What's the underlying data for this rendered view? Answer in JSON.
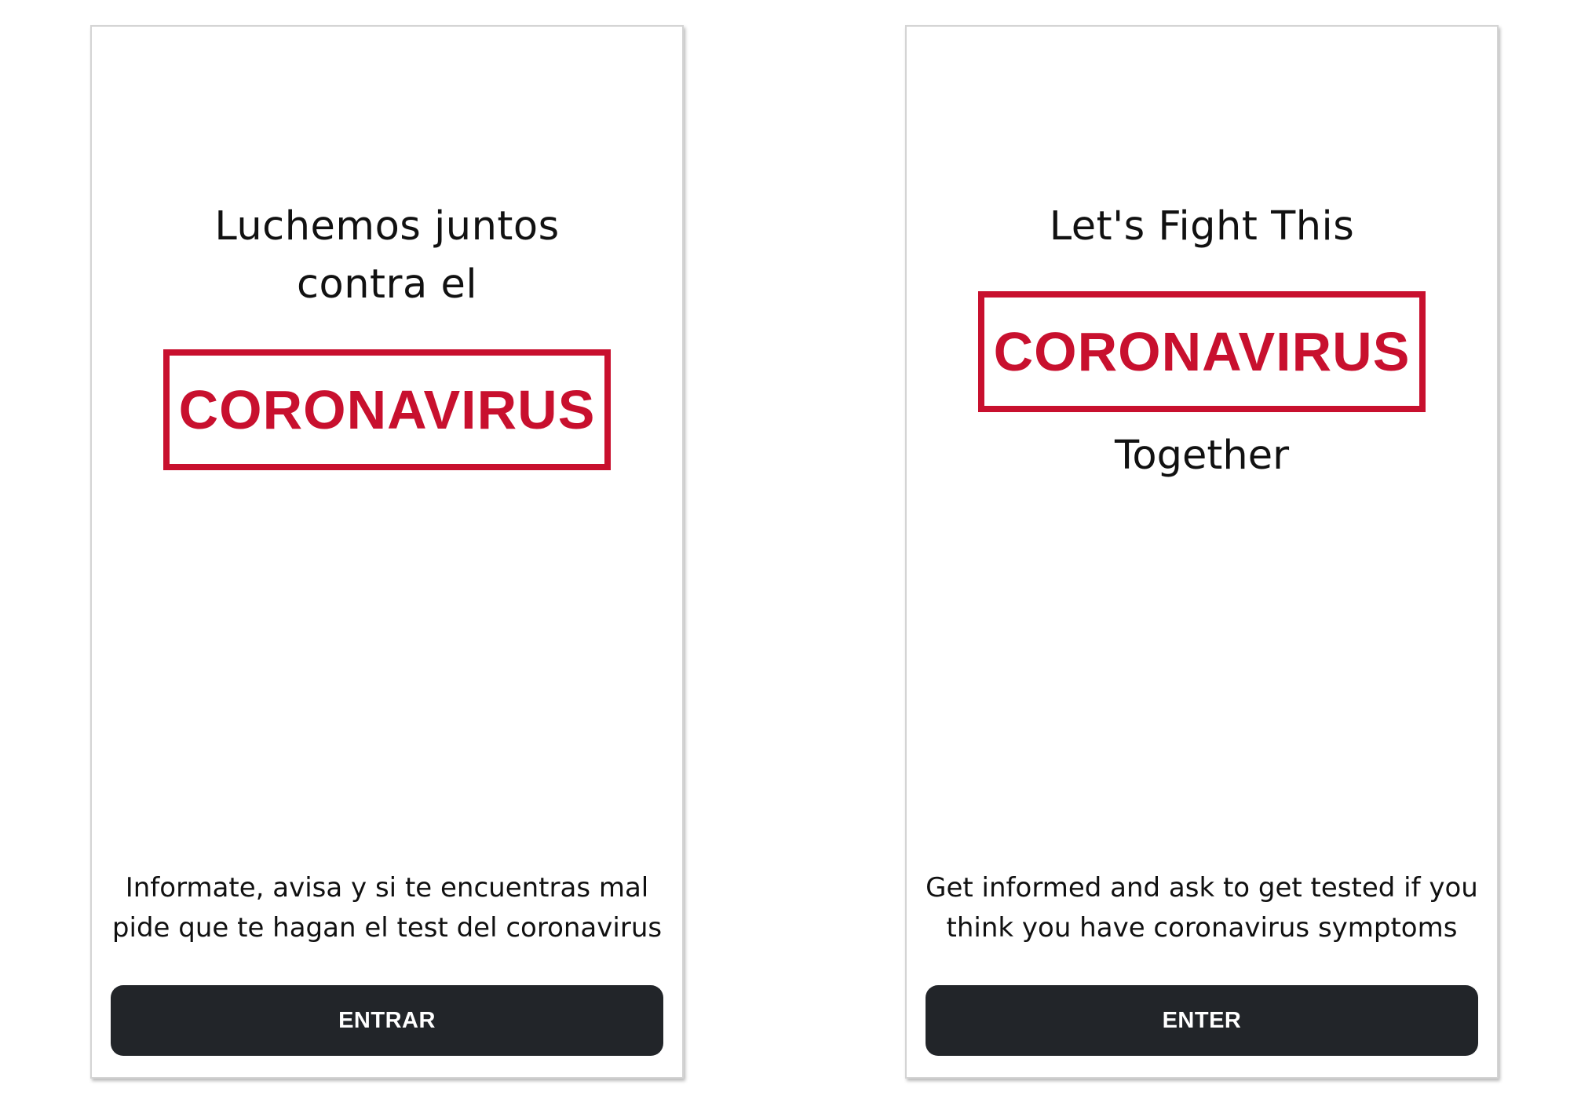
{
  "screens": [
    {
      "language": "es",
      "headline_line1": "Luchemos juntos",
      "headline_line2": "contra el",
      "stamp_text": "CORONAVIRUS",
      "info_line1": "Informate, avisa y si te encuentras mal",
      "info_line2": "pide que te hagan el test del coronavirus",
      "button_label": "ENTRAR"
    },
    {
      "language": "en",
      "headline_line1": "Let's Fight This",
      "stamp_text": "CORONAVIRUS",
      "headline_after": "Together",
      "info_line1": "Get informed and ask to get tested if you",
      "info_line2": "think you have coronavirus symptoms",
      "button_label": "ENTER"
    }
  ],
  "colors": {
    "accent_red": "#c8102e",
    "button_bg": "#222529",
    "button_text": "#ffffff",
    "text": "#111111"
  }
}
